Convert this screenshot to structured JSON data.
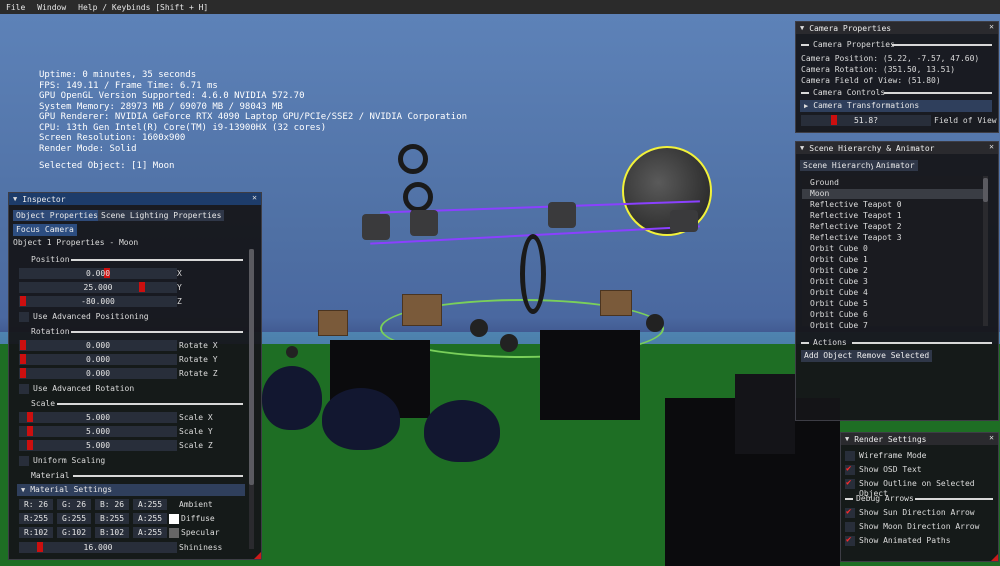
{
  "menu": [
    "File",
    "Window",
    "Help / Keybinds [Shift + H]"
  ],
  "osd": {
    "lines": [
      "Uptime: 0 minutes, 35 seconds",
      "FPS: 149.11 / Frame Time: 6.71 ms",
      "GPU OpenGL Version Supported: 4.6.0 NVIDIA 572.70",
      "System Memory: 28973 MB / 69070 MB / 98043 MB",
      "GPU Renderer: NVIDIA GeForce RTX 4090 Laptop GPU/PCIe/SSE2 / NVIDIA Corporation",
      "CPU: 13th Gen Intel(R) Core(TM) i9-13900HX (32 cores)",
      "Screen Resolution: 1600x900",
      "Render Mode: Solid"
    ],
    "selected": "Selected Object: [1] Moon"
  },
  "inspector": {
    "title": "Inspector",
    "tabs": [
      "Object Properties",
      "Scene Lighting Properties"
    ],
    "focus_button": "Focus Camera",
    "subtitle": "Object 1 Properties - Moon",
    "position": {
      "header": "Position",
      "x": "0.000",
      "y": "25.000",
      "z": "-80.000",
      "lx": "X",
      "ly": "Y",
      "lz": "Z",
      "advanced": "Use Advanced Positioning"
    },
    "rotation": {
      "header": "Rotation",
      "x": "0.000",
      "y": "0.000",
      "z": "0.000",
      "lx": "Rotate X",
      "ly": "Rotate Y",
      "lz": "Rotate Z",
      "advanced": "Use Advanced Rotation"
    },
    "scale": {
      "header": "Scale",
      "x": "5.000",
      "y": "5.000",
      "z": "5.000",
      "lx": "Scale X",
      "ly": "Scale Y",
      "lz": "Scale Z",
      "uniform": "Uniform Scaling"
    },
    "material": {
      "header": "Material",
      "settings": "Material Settings",
      "ambient": {
        "r": "R: 26",
        "g": "G: 26",
        "b": "B: 26",
        "a": "A:255",
        "label": "Ambient"
      },
      "diffuse": {
        "r": "R:255",
        "g": "G:255",
        "b": "B:255",
        "a": "A:255",
        "label": "Diffuse",
        "color": "#ffffff"
      },
      "specular": {
        "r": "R:102",
        "g": "G:102",
        "b": "B:102",
        "a": "A:255",
        "label": "Specular",
        "color": "#666666"
      },
      "shininess": {
        "value": "16.000",
        "label": "Shininess"
      }
    }
  },
  "camera": {
    "title": "Camera Properties",
    "section": "Camera Properties",
    "position": "Camera Position: (5.22, -7.57, 47.60)",
    "rotation": "Camera Rotation: (351.50, 13.51)",
    "fov": "Camera Field of View: (51.80)",
    "controls": "Camera Controls",
    "transforms": "Camera Transformations",
    "fov_value": "51.8?",
    "fov_label": "Field of View"
  },
  "hierarchy": {
    "title": "Scene Hierarchy & Animator",
    "tabs": [
      "Scene Hierarchy",
      "Animator"
    ],
    "items": [
      "Ground",
      "Moon",
      "Reflective Teapot 0",
      "Reflective Teapot 1",
      "Reflective Teapot 2",
      "Reflective Teapot 3",
      "Orbit Cube 0",
      "Orbit Cube 1",
      "Orbit Cube 2",
      "Orbit Cube 3",
      "Orbit Cube 4",
      "Orbit Cube 5",
      "Orbit Cube 6",
      "Orbit Cube 7"
    ],
    "selected_index": 1,
    "actions": "Actions",
    "add": "Add Object",
    "remove": "Remove Selected"
  },
  "render": {
    "title": "Render Settings",
    "wireframe": "Wireframe Mode",
    "osd": "Show OSD Text",
    "outline": "Show Outline on Selected Object",
    "debug": "Debug Arrows",
    "sun": "Show Sun Direction Arrow",
    "moon": "Show Moon Direction Arrow",
    "paths": "Show Animated Paths",
    "checked": {
      "wireframe": false,
      "osd": true,
      "outline": true,
      "sun": true,
      "moon": false,
      "paths": true
    }
  }
}
